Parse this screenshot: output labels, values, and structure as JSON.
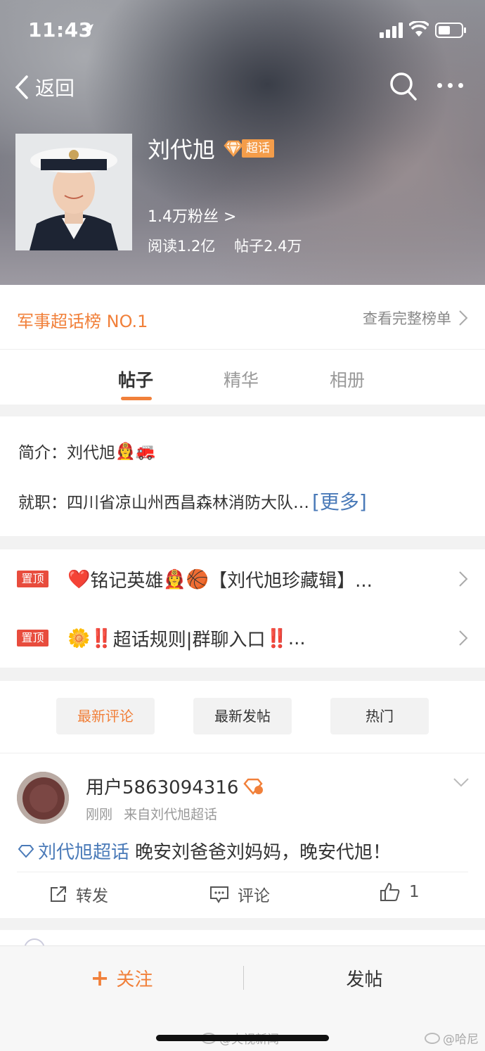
{
  "status_bar": {
    "time": "11:43"
  },
  "nav": {
    "back_label": "返回"
  },
  "profile": {
    "name": "刘代旭",
    "badge_label": "超话",
    "fans": "1.4万粉丝 >",
    "reads": "阅读1.2亿",
    "posts": "帖子2.4万"
  },
  "rank": {
    "title": "军事超话榜 NO.1",
    "link_label": "查看完整榜单"
  },
  "tabs": [
    {
      "label": "帖子"
    },
    {
      "label": "精华"
    },
    {
      "label": "相册"
    }
  ],
  "intro": {
    "intro_label": "简介：",
    "intro_value": "刘代旭",
    "intro_emoji": "👩‍🚒🚒",
    "job_label": "就职：",
    "job_value": "四川省凉山州西昌森林消防大队…",
    "more_label": "[更多]"
  },
  "pinned": [
    {
      "tag": "置顶",
      "prefix": "❤️",
      "text_a": "铭记英雄",
      "emoji": "👩‍🚒🏀",
      "text_b": "【刘代旭珍藏辑】..."
    },
    {
      "tag": "置顶",
      "prefix": "🌼‼️",
      "text_a": "超话规则|群聊入口",
      "emoji": "‼️",
      "text_b": "..."
    }
  ],
  "filters": [
    {
      "label": "最新评论"
    },
    {
      "label": "最新发帖"
    },
    {
      "label": "热门"
    }
  ],
  "post": {
    "username": "用户5863094316",
    "time": "刚刚",
    "source": "来自刘代旭超话",
    "topic": "刘代旭超话",
    "text": "晚安刘爸爸刘妈妈，晚安代旭！",
    "repost_label": "转发",
    "comment_label": "评论",
    "like_count": "1"
  },
  "bottom": {
    "follow_plus": "+",
    "follow_label": "关注",
    "post_label": "发帖",
    "watermark_left": "@央视新闻",
    "watermark_right": "@哈尼"
  },
  "colors": {
    "accent": "#f1803a",
    "link": "#4a7ab8",
    "pin_tag": "#e84c3d"
  }
}
